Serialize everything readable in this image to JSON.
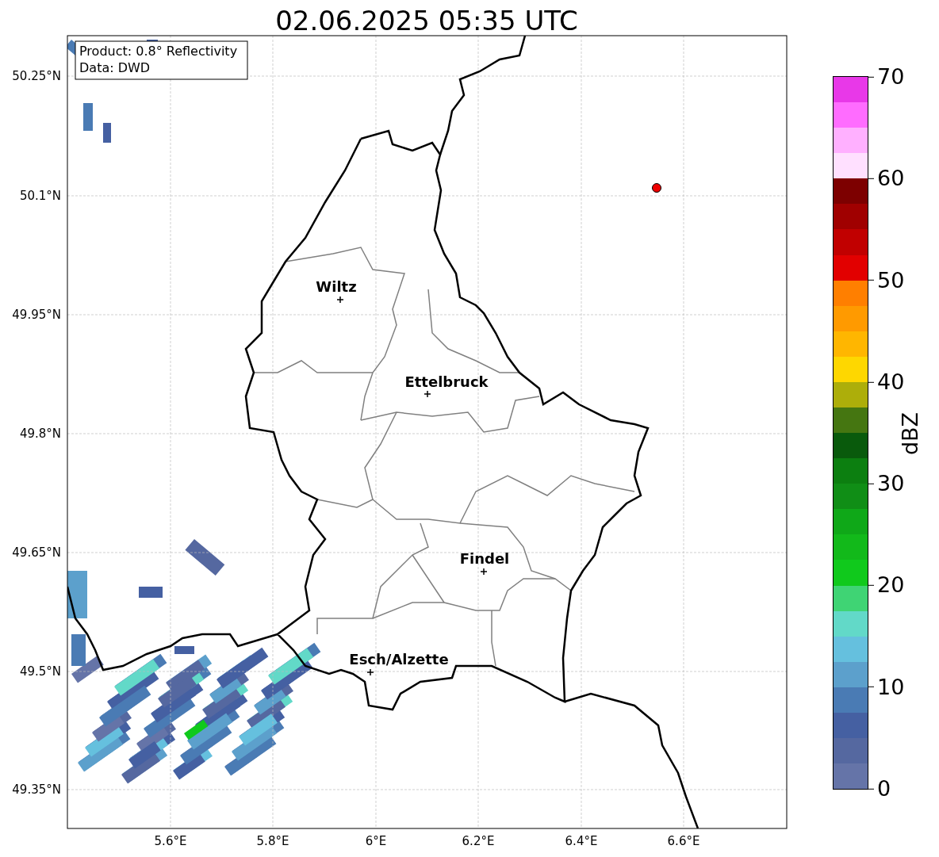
{
  "title": "02.06.2025 05:35 UTC",
  "info_box": [
    "Product: 0.8° Reflectivity",
    "Data: DWD"
  ],
  "lat_ticks": [
    "50.25°N",
    "50.1°N",
    "49.95°N",
    "49.8°N",
    "49.65°N",
    "49.5°N",
    "49.35°N"
  ],
  "lon_ticks": [
    "5.6°E",
    "5.8°E",
    "6°E",
    "6.2°E",
    "6.4°E",
    "6.6°E"
  ],
  "cities": [
    {
      "name": "Wiltz"
    },
    {
      "name": "Ettelbruck"
    },
    {
      "name": "Findel"
    },
    {
      "name": "Esch/Alzette"
    }
  ],
  "colorbar": {
    "label": "dBZ",
    "ticks": [
      "70",
      "60",
      "50",
      "40",
      "30",
      "20",
      "10",
      "0"
    ],
    "bands": [
      {
        "color": "#e838e8"
      },
      {
        "color": "#ff6cff"
      },
      {
        "color": "#ffb0ff"
      },
      {
        "color": "#ffe0ff"
      },
      {
        "color": "#7d0000"
      },
      {
        "color": "#a00000"
      },
      {
        "color": "#c10000"
      },
      {
        "color": "#e20000"
      },
      {
        "color": "#ff7f00"
      },
      {
        "color": "#ff9a00"
      },
      {
        "color": "#ffb600"
      },
      {
        "color": "#fed700"
      },
      {
        "color": "#adae0a"
      },
      {
        "color": "#457611"
      },
      {
        "color": "#095a0c"
      },
      {
        "color": "#0c7f10"
      },
      {
        "color": "#108e16"
      },
      {
        "color": "#0fa818"
      },
      {
        "color": "#12b91a"
      },
      {
        "color": "#10c91c"
      },
      {
        "color": "#3fd474"
      },
      {
        "color": "#62d9c8"
      },
      {
        "color": "#65c0de"
      },
      {
        "color": "#5ca0cc"
      },
      {
        "color": "#4a7bb4"
      },
      {
        "color": "#4560a2"
      },
      {
        "color": "#5568a0"
      },
      {
        "color": "#6574a8"
      }
    ]
  }
}
